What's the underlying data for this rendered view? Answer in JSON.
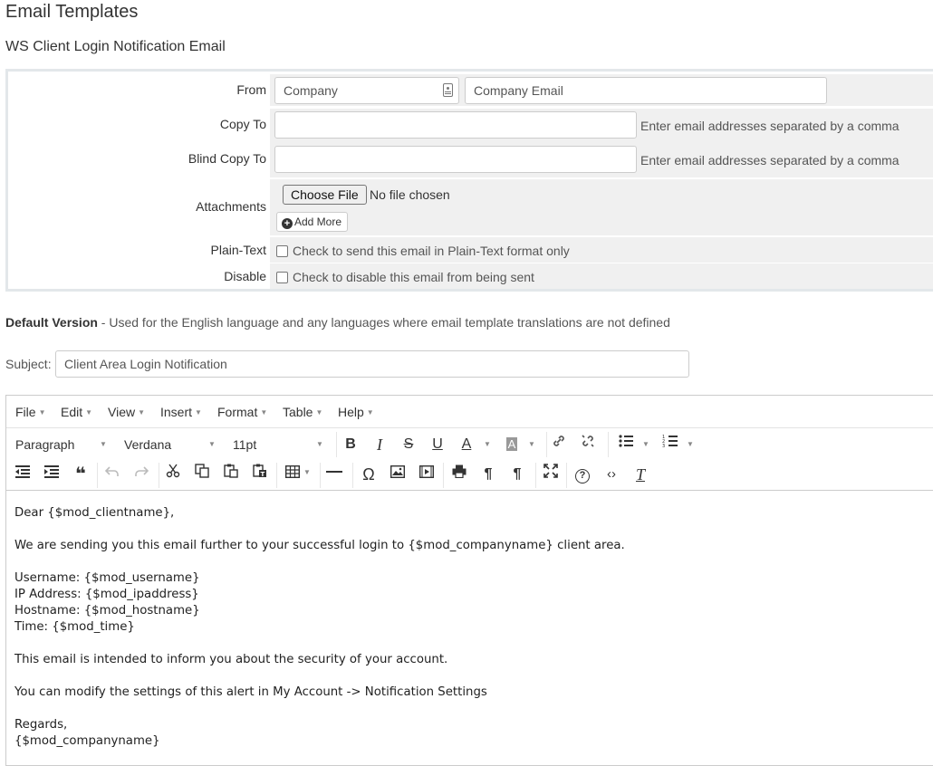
{
  "page": {
    "title": "Email Templates",
    "subtitle": "WS Client Login Notification Email"
  },
  "form": {
    "from": {
      "label": "From",
      "name_value": "Company",
      "email_value": "Company Email"
    },
    "copy_to": {
      "label": "Copy To",
      "value": "",
      "hint": "Enter email addresses separated by a comma"
    },
    "blind_copy_to": {
      "label": "Blind Copy To",
      "value": "",
      "hint": "Enter email addresses separated by a comma"
    },
    "attachments": {
      "label": "Attachments",
      "choose_button": "Choose File",
      "no_file_text": "No file chosen",
      "add_more_button": "Add More"
    },
    "plain_text": {
      "label": "Plain-Text",
      "checkbox_text": "Check to send this email in Plain-Text format only",
      "checked": false
    },
    "disable": {
      "label": "Disable",
      "checkbox_text": "Check to disable this email from being sent",
      "checked": false
    }
  },
  "default_version": {
    "heading": "Default Version",
    "description": " - Used for the English language and any languages where email template translations are not defined"
  },
  "subject": {
    "label": "Subject:",
    "value": "Client Area Login Notification"
  },
  "editor": {
    "menu": [
      "File",
      "Edit",
      "View",
      "Insert",
      "Format",
      "Table",
      "Help"
    ],
    "block_format": "Paragraph",
    "font_family": "Verdana",
    "font_size": "11pt",
    "toolbar_icons": {
      "bold": "B",
      "italic": "I",
      "strikethrough": "S",
      "underline": "U",
      "text_color": "A",
      "bg_color": "A",
      "blockquote": "❝",
      "omega": "Ω",
      "help": "?",
      "code": "‹›",
      "clear_format": "T",
      "ltr": "¶",
      "rtl": "¶"
    },
    "content_lines": [
      "Dear {$mod_clientname},",
      "",
      "We are sending you this email further to your successful login to {$mod_companyname} client area.",
      "",
      "Username: {$mod_username}",
      "IP Address: {$mod_ipaddress}",
      "Hostname: {$mod_hostname}",
      "Time: {$mod_time}",
      "",
      "This email is intended to inform you about the security of your account.",
      "",
      "You can modify the settings of this alert in My Account -> Notification Settings",
      "",
      "Regards,",
      "{$mod_companyname}"
    ]
  },
  "colors": {
    "form_border": "#e3e7ea",
    "field_bg": "#f0f0f0",
    "input_border": "#cccccc"
  }
}
